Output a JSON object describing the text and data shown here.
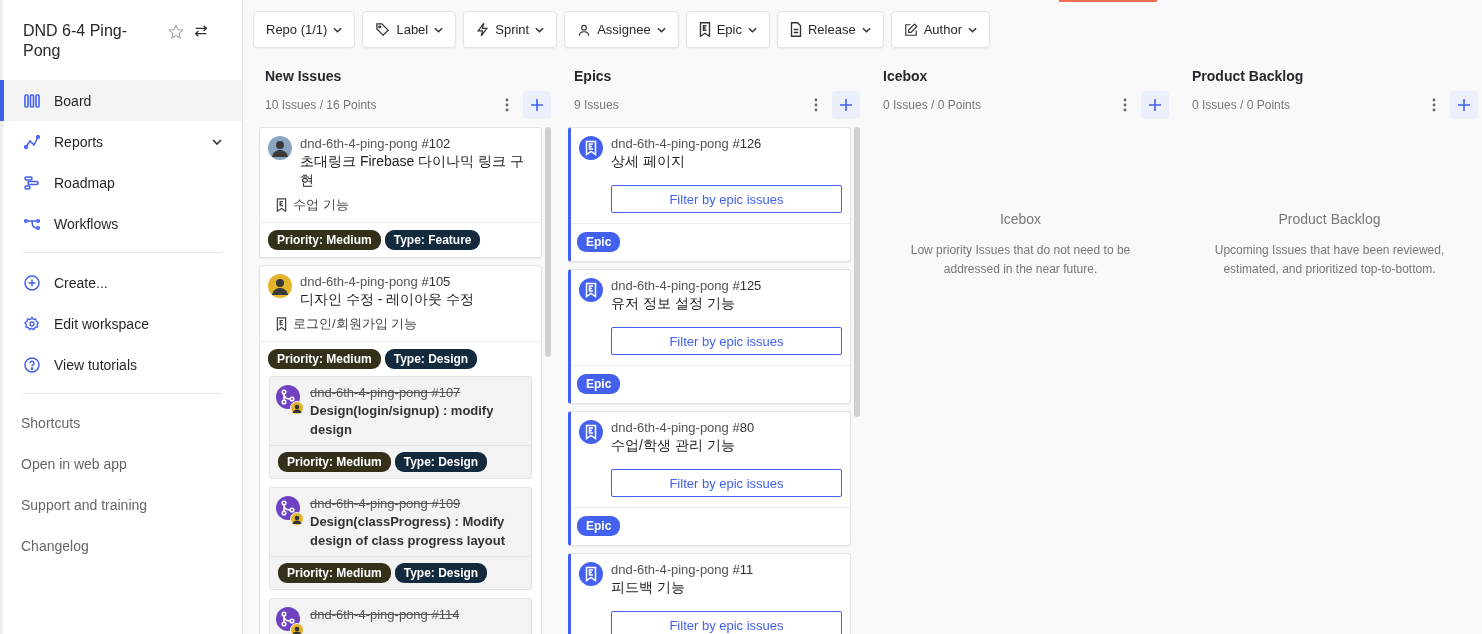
{
  "sidebar": {
    "workspace_title": "DND 6-4 Ping-Pong",
    "starred": false,
    "nav": [
      {
        "label": "Board",
        "selected": true,
        "expandable": false
      },
      {
        "label": "Reports",
        "selected": false,
        "expandable": true
      },
      {
        "label": "Roadmap",
        "selected": false,
        "expandable": false
      },
      {
        "label": "Workflows",
        "selected": false,
        "expandable": false
      }
    ],
    "actions": [
      {
        "label": "Create..."
      },
      {
        "label": "Edit workspace"
      },
      {
        "label": "View tutorials"
      }
    ],
    "links": [
      {
        "label": "Shortcuts"
      },
      {
        "label": "Open in web app"
      },
      {
        "label": "Support and training"
      },
      {
        "label": "Changelog"
      }
    ]
  },
  "filters": [
    {
      "label": "Repo (1/1)"
    },
    {
      "label": "Label"
    },
    {
      "label": "Sprint"
    },
    {
      "label": "Assignee"
    },
    {
      "label": "Epic"
    },
    {
      "label": "Release"
    },
    {
      "label": "Author"
    }
  ],
  "columns": [
    {
      "kind": "issues",
      "title": "New Issues",
      "meta": "10 Issues / 16 Points",
      "cards": [
        {
          "repo": "dnd-6th-4-ping-pong",
          "number": "#102",
          "title": "초대링크 Firebase 다이나믹 링크 구현",
          "epic": "수업 기능",
          "labels": [
            {
              "text": "Priority: Medium",
              "color": "#34301a"
            },
            {
              "text": "Type: Feature",
              "color": "#13293d"
            }
          ]
        },
        {
          "repo": "dnd-6th-4-ping-pong",
          "number": "#105",
          "title": "디자인 수정 - 레이아웃 수정",
          "epic": "로그인/회원가입 기능",
          "labels": [
            {
              "text": "Priority: Medium",
              "color": "#34301a"
            },
            {
              "text": "Type: Design",
              "color": "#13293d"
            }
          ],
          "subcards": [
            {
              "repo": "dnd-6th-4-ping-pong",
              "number": "#107",
              "closed": true,
              "title": "Design(login/signup) : modify design",
              "labels": [
                {
                  "text": "Priority: Medium",
                  "color": "#34301a"
                },
                {
                  "text": "Type: Design",
                  "color": "#13293d"
                }
              ]
            },
            {
              "repo": "dnd-6th-4-ping-pong",
              "number": "#109",
              "closed": true,
              "title": "Design(classProgress) : Modify design of class progress layout",
              "labels": [
                {
                  "text": "Priority: Medium",
                  "color": "#34301a"
                },
                {
                  "text": "Type: Design",
                  "color": "#13293d"
                }
              ]
            },
            {
              "repo": "dnd-6th-4-ping-pong",
              "number": "#114",
              "closed": true
            }
          ]
        }
      ]
    },
    {
      "kind": "epics",
      "title": "Epics",
      "meta": "9 Issues",
      "cards": [
        {
          "repo": "dnd-6th-4-ping-pong",
          "number": "#126",
          "title": "상세 페이지",
          "button": "Filter by epic issues",
          "label": "Epic"
        },
        {
          "repo": "dnd-6th-4-ping-pong",
          "number": "#125",
          "title": "유저 정보 설정 기능",
          "button": "Filter by epic issues",
          "label": "Epic"
        },
        {
          "repo": "dnd-6th-4-ping-pong",
          "number": "#80",
          "title": "수업/학생 관리 기능",
          "button": "Filter by epic issues",
          "label": "Epic"
        },
        {
          "repo": "dnd-6th-4-ping-pong",
          "number": "#11",
          "title": "피드백 기능",
          "button": "Filter by epic issues"
        }
      ]
    },
    {
      "kind": "empty",
      "title": "Icebox",
      "meta": "0 Issues / 0 Points",
      "empty_title": "Icebox",
      "empty_text": "Low priority Issues that do not need to be addressed in the near future."
    },
    {
      "kind": "empty",
      "title": "Product Backlog",
      "meta": "0 Issues / 0 Points",
      "empty_title": "Product Backlog",
      "empty_text": "Upcoming Issues that have been reviewed, estimated, and prioritized top-to-bottom."
    }
  ]
}
